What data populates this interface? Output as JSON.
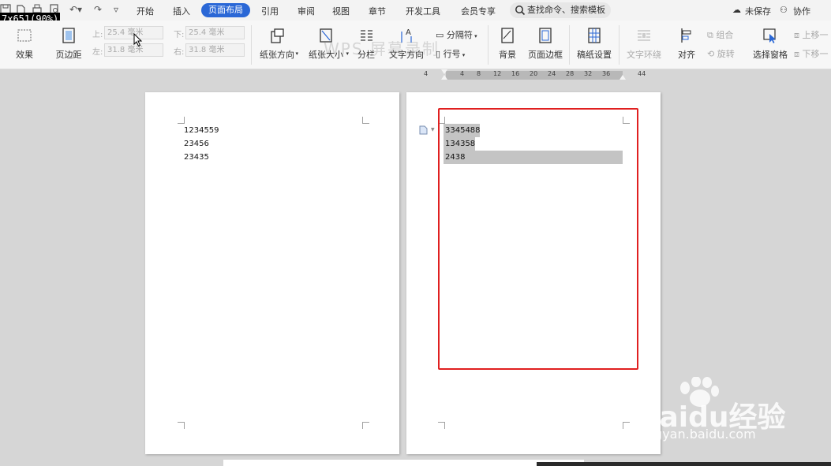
{
  "overlay_tag": "7x651(90%)",
  "menubar": {
    "tabs": [
      "开始",
      "插入",
      "页面布局",
      "引用",
      "审阅",
      "视图",
      "章节",
      "开发工具",
      "会员专享"
    ],
    "active_tab": "页面布局",
    "search_label": "查找命令、搜索模板",
    "unsaved_label": "未保存",
    "collab_label": "协作",
    "active_color": "#2a67d6"
  },
  "ribbon": {
    "effect_label": "效果",
    "margin_label": "页边距",
    "margin_top_label": "上:",
    "margin_top_value": "25.4 毫米",
    "margin_bottom_label": "下:",
    "margin_bottom_value": "25.4 毫米",
    "margin_left_label": "左:",
    "margin_left_value": "31.8 毫米",
    "margin_right_label": "右:",
    "margin_right_value": "31.8 毫米",
    "orientation_label": "纸张方向",
    "size_label": "纸张大小",
    "columns_label": "分栏",
    "text_direction_label": "文字方向",
    "separator_label": "分隔符",
    "line_number_label": "行号",
    "background_label": "背景",
    "page_border_label": "页面边框",
    "manuscript_label": "稿纸设置",
    "text_wrap_label": "文字环绕",
    "align_label": "对齐",
    "group_label": "组合",
    "rotate_label": "旋转",
    "selection_pane_label": "选择窗格",
    "bring_up_label": "上移一",
    "send_down_label": "下移一",
    "watermark_text": "WPS 屏幕录制"
  },
  "ruler": {
    "ticks": [
      "4",
      "4",
      "8",
      "12",
      "16",
      "20",
      "24",
      "28",
      "32",
      "36",
      "44"
    ]
  },
  "page1": {
    "lines": [
      "1234559",
      "23456",
      "23435"
    ]
  },
  "page2": {
    "lines": [
      "3345488",
      "134358",
      "2438"
    ]
  },
  "watermark": {
    "logo": "Baidu经验",
    "site": "jingyan.baidu.com"
  },
  "colors": {
    "highlight_box": "#e02020",
    "selection": "#c4c4c4"
  }
}
